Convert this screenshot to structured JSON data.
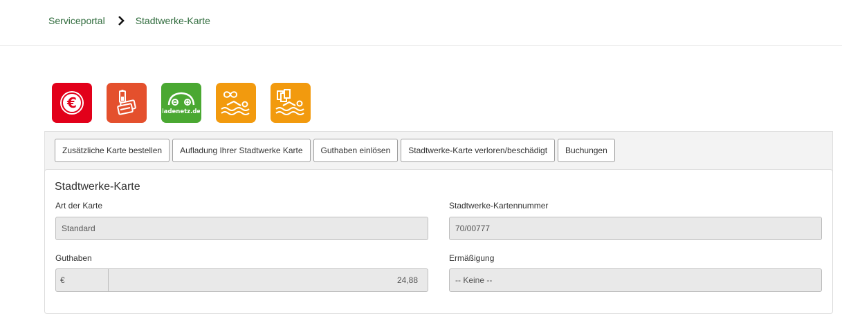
{
  "breadcrumb": {
    "items": [
      "Serviceportal",
      "Stadtwerke-Karte"
    ]
  },
  "tiles": [
    {
      "icon": "euro-icon",
      "color": "#e2001a"
    },
    {
      "icon": "charge-card-icon",
      "color": "#e4502d"
    },
    {
      "icon": "ladenetz-car-icon",
      "color": "#4aa832",
      "text": "ladenetz.de"
    },
    {
      "icon": "swim-infinity-icon",
      "color": "#f29a0e"
    },
    {
      "icon": "swim-tickets-icon",
      "color": "#f29a0e"
    }
  ],
  "tabs": [
    "Zusätzliche Karte bestellen",
    "Aufladung Ihrer Stadtwerke Karte",
    "Guthaben einlösen",
    "Stadtwerke-Karte verloren/beschädigt",
    "Buchungen"
  ],
  "card": {
    "title": "Stadtwerke-Karte",
    "art_label": "Art der Karte",
    "art_value": "Standard",
    "nummer_label": "Stadtwerke-Kartennummer",
    "nummer_value": "70/00777",
    "guthaben_label": "Guthaben",
    "guthaben_currency": "€",
    "guthaben_value": "24,88",
    "ermaessigung_label": "Ermäßigung",
    "ermaessigung_value": "-- Keine --"
  },
  "colors": {
    "link_green": "#2f6b3c",
    "field_bg": "#e9e9e9"
  }
}
